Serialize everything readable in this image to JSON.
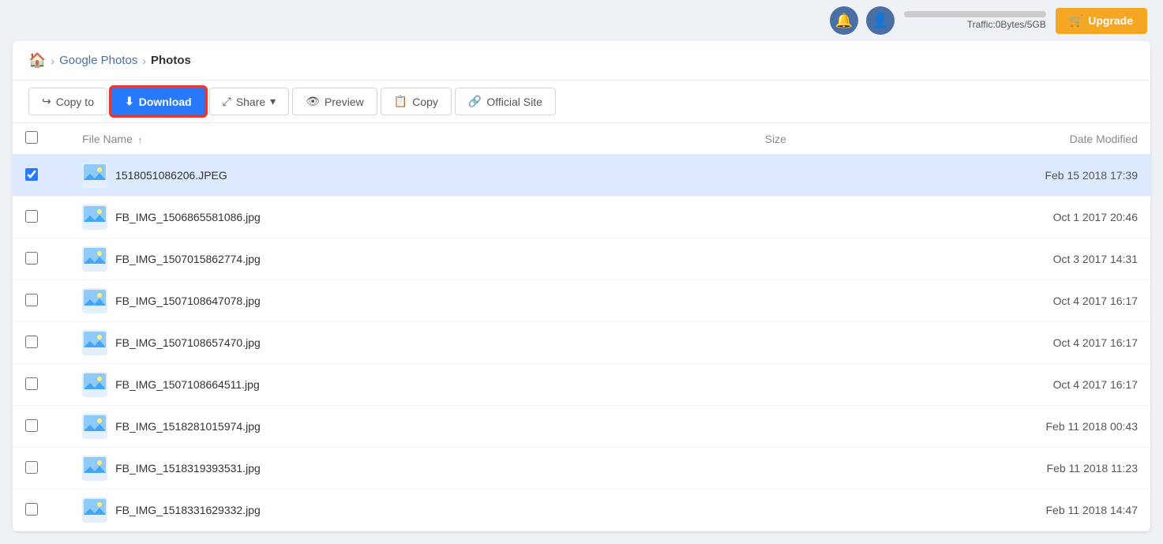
{
  "header": {
    "traffic_label": "Traffic:0Bytes/5GB",
    "upgrade_label": "Upgrade"
  },
  "breadcrumb": {
    "home_icon": "🏠",
    "google_photos": "Google Photos",
    "current": "Photos"
  },
  "toolbar": {
    "copy_to_label": "Copy to",
    "download_label": "Download",
    "share_label": "Share",
    "preview_label": "Preview",
    "copy_label": "Copy",
    "official_site_label": "Official Site"
  },
  "table": {
    "col_filename": "File Name",
    "col_size": "Size",
    "col_date": "Date Modified",
    "rows": [
      {
        "id": 1,
        "name": "1518051086206.JPEG",
        "size": "",
        "date": "Feb 15 2018 17:39",
        "selected": true
      },
      {
        "id": 2,
        "name": "FB_IMG_1506865581086.jpg",
        "size": "",
        "date": "Oct 1 2017 20:46",
        "selected": false
      },
      {
        "id": 3,
        "name": "FB_IMG_1507015862774.jpg",
        "size": "",
        "date": "Oct 3 2017 14:31",
        "selected": false
      },
      {
        "id": 4,
        "name": "FB_IMG_1507108647078.jpg",
        "size": "",
        "date": "Oct 4 2017 16:17",
        "selected": false
      },
      {
        "id": 5,
        "name": "FB_IMG_1507108657470.jpg",
        "size": "",
        "date": "Oct 4 2017 16:17",
        "selected": false
      },
      {
        "id": 6,
        "name": "FB_IMG_1507108664511.jpg",
        "size": "",
        "date": "Oct 4 2017 16:17",
        "selected": false
      },
      {
        "id": 7,
        "name": "FB_IMG_1518281015974.jpg",
        "size": "",
        "date": "Feb 11 2018 00:43",
        "selected": false
      },
      {
        "id": 8,
        "name": "FB_IMG_1518319393531.jpg",
        "size": "",
        "date": "Feb 11 2018 11:23",
        "selected": false
      },
      {
        "id": 9,
        "name": "FB_IMG_1518331629332.jpg",
        "size": "",
        "date": "Feb 11 2018 14:47",
        "selected": false
      }
    ]
  }
}
